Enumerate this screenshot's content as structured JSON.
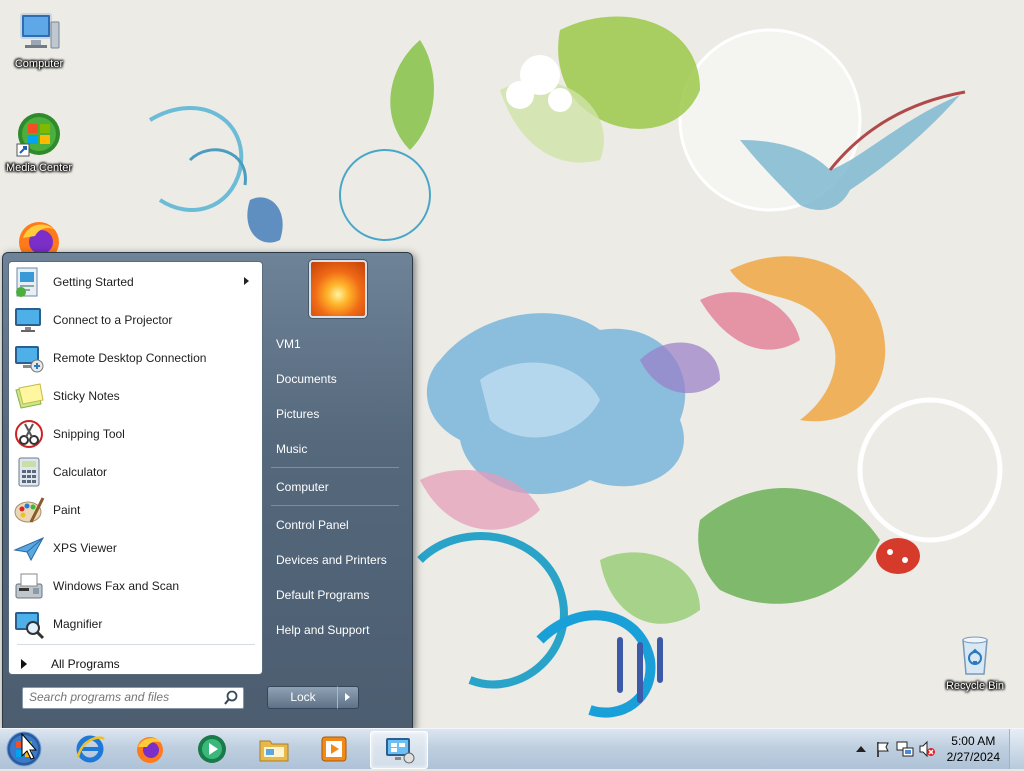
{
  "desktop": {
    "icons": [
      {
        "label": "Computer",
        "icon": "computer-icon"
      },
      {
        "label": "Media Center",
        "icon": "media-center-icon"
      },
      {
        "label": "Recycle Bin",
        "icon": "recycle-bin-icon"
      }
    ]
  },
  "start_menu": {
    "programs": [
      {
        "label": "Getting Started",
        "icon": "getting-started-icon",
        "submenu": true
      },
      {
        "label": "Connect to a Projector",
        "icon": "projector-icon"
      },
      {
        "label": "Remote Desktop Connection",
        "icon": "remote-desktop-icon"
      },
      {
        "label": "Sticky Notes",
        "icon": "sticky-notes-icon"
      },
      {
        "label": "Snipping Tool",
        "icon": "snipping-tool-icon"
      },
      {
        "label": "Calculator",
        "icon": "calculator-icon"
      },
      {
        "label": "Paint",
        "icon": "paint-icon"
      },
      {
        "label": "XPS Viewer",
        "icon": "xps-viewer-icon"
      },
      {
        "label": "Windows Fax and Scan",
        "icon": "fax-scan-icon"
      },
      {
        "label": "Magnifier",
        "icon": "magnifier-icon"
      }
    ],
    "all_programs": "All Programs",
    "search_placeholder": "Search programs and files",
    "right_items": {
      "user": "VM1",
      "documents": "Documents",
      "pictures": "Pictures",
      "music": "Music",
      "computer": "Computer",
      "control_panel": "Control Panel",
      "devices_printers": "Devices and Printers",
      "default_programs": "Default Programs",
      "help_support": "Help and Support"
    },
    "lock": "Lock"
  },
  "taskbar": {
    "pinned": [
      "internet-explorer-icon",
      "firefox-icon",
      "media-player-icon",
      "file-explorer-icon",
      "video-player-icon",
      "control-panel-icon"
    ],
    "clock_time": "5:00 AM",
    "clock_date": "2/27/2024"
  }
}
